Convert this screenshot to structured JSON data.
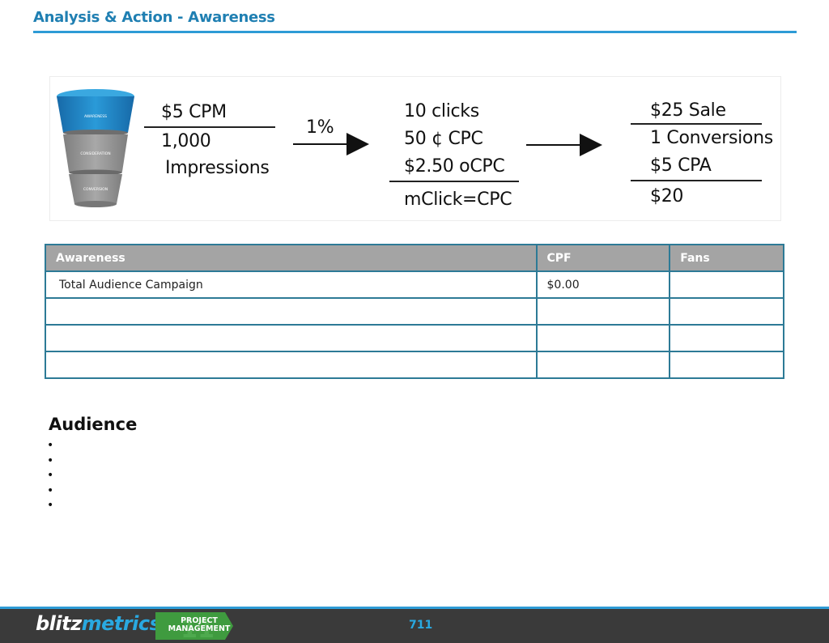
{
  "header": {
    "title": "Analysis & Action - Awareness"
  },
  "funnel": {
    "stages": [
      "AWARENESS",
      "CONSIDERATION",
      "CONVERSION"
    ],
    "colors": {
      "top": "#1e88c7",
      "middle": "#9a9a9a",
      "bottom": "#8a8a8a"
    }
  },
  "formula": {
    "cpm": "$5 CPM",
    "impressions_count": "1,000",
    "impressions_label": "Impressions",
    "rate": "1%",
    "clicks": "10 clicks",
    "cpc": "50 ¢ CPC",
    "ocpc": "$2.50 oCPC",
    "mclick": "mClick=CPC",
    "sale": "$25 Sale",
    "conversions": "1 Conversions",
    "cpa": "$5 CPA",
    "profit": "$20"
  },
  "table": {
    "headers": [
      "Awareness",
      "CPF",
      "Fans"
    ],
    "rows": [
      [
        "Total Audience Campaign",
        "$0.00",
        ""
      ],
      [
        "",
        "",
        ""
      ],
      [
        "",
        "",
        ""
      ],
      [
        "",
        "",
        ""
      ]
    ],
    "header_color": "#a4a4a4",
    "border_color": "#2d7a96"
  },
  "audience": {
    "title": "Audience",
    "bullets": [
      "•",
      "•",
      "•",
      "•",
      "•"
    ]
  },
  "footer": {
    "brand_part1": "blitz",
    "brand_part2": "metrics",
    "badge_line1": "PROJECT",
    "badge_line2": "MANAGEMENT",
    "page_number": "711",
    "accent": "#29a9e1",
    "badge_color": "#3f9b3f"
  }
}
